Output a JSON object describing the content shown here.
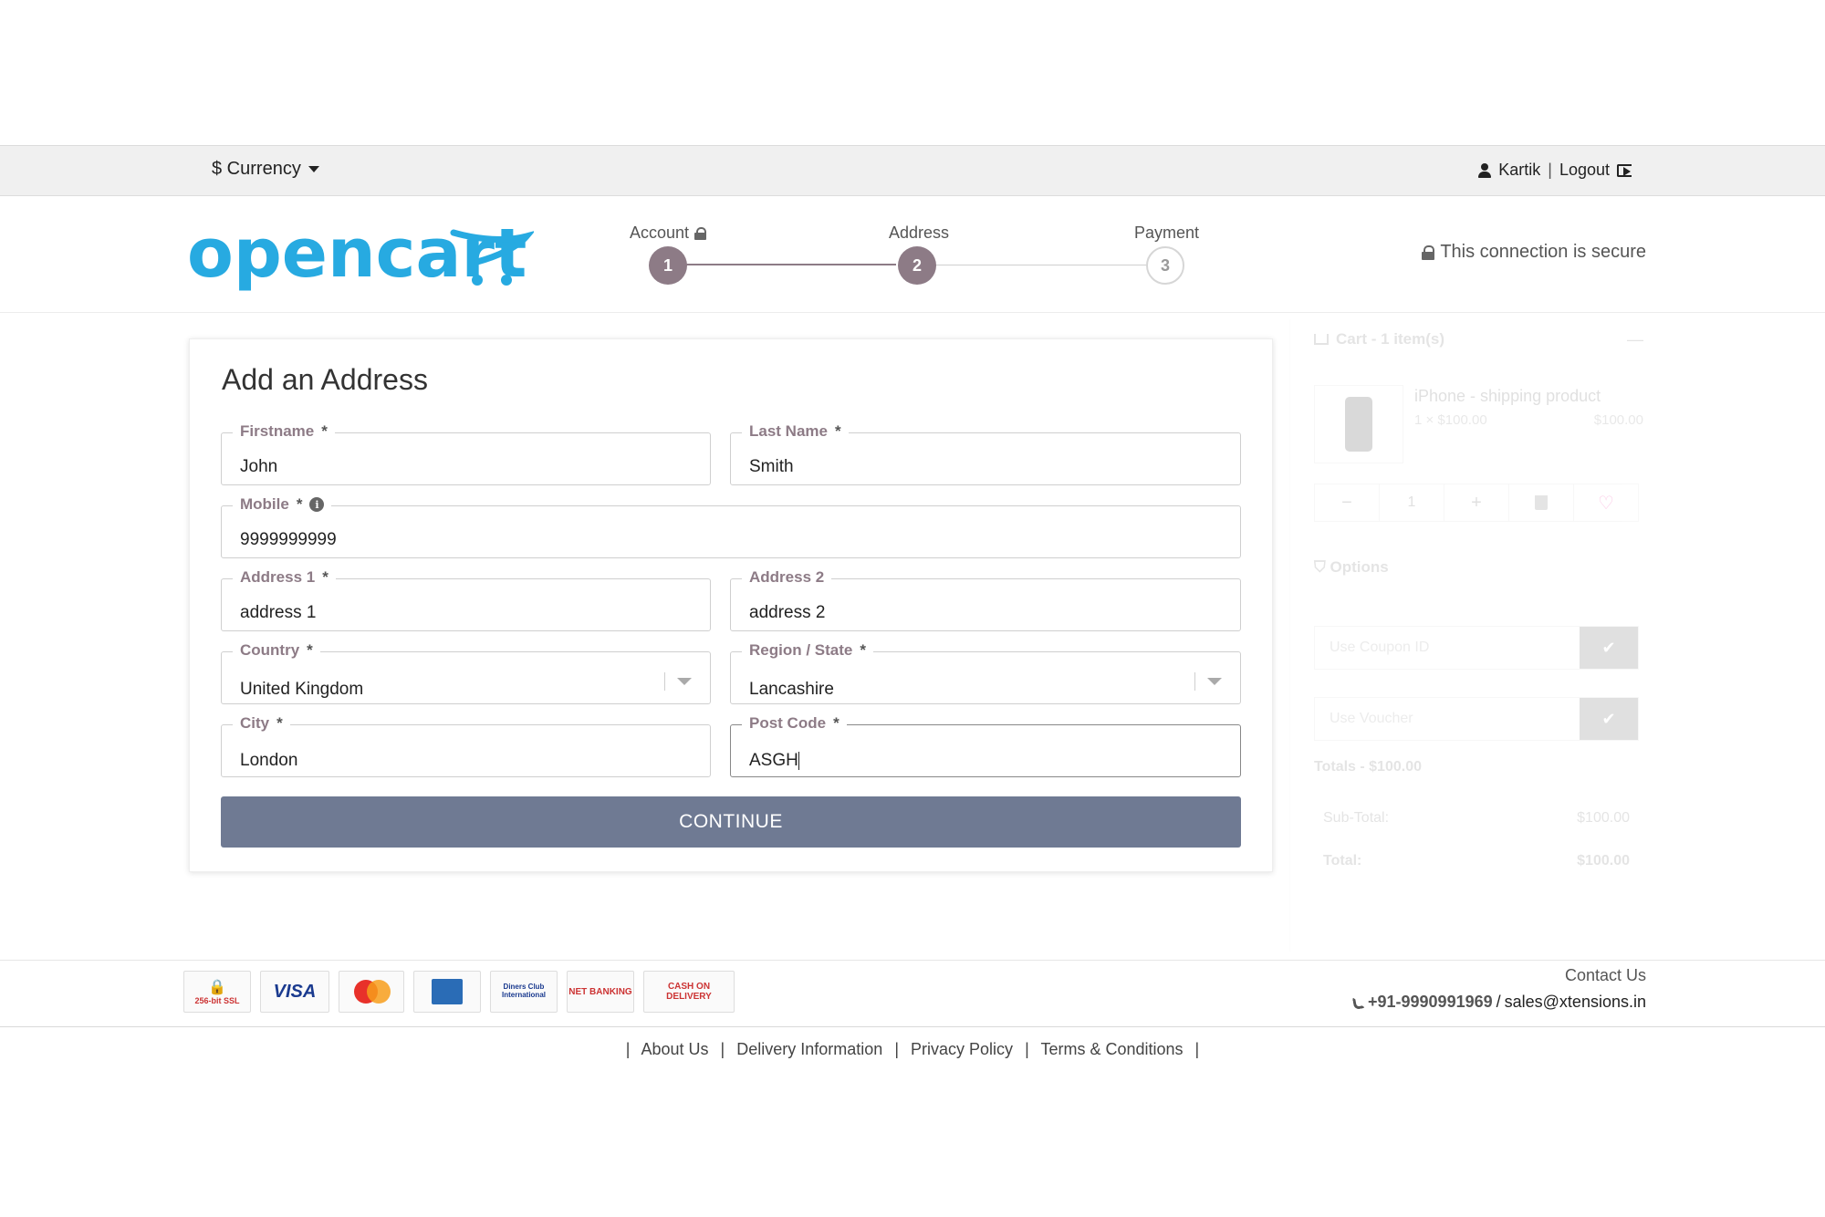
{
  "topbar": {
    "currency_label": "$ Currency",
    "user_name": "Kartik",
    "separator": "|",
    "logout_label": "Logout"
  },
  "header": {
    "logo_text": "opencart",
    "secure_text": "This connection is secure",
    "steps": [
      {
        "label": "Account",
        "number": "1",
        "state": "done"
      },
      {
        "label": "Address",
        "number": "2",
        "state": "current"
      },
      {
        "label": "Payment",
        "number": "3",
        "state": "todo"
      }
    ]
  },
  "form": {
    "title": "Add an Address",
    "required_mark": "*",
    "firstname": {
      "label": "Firstname",
      "value": "John"
    },
    "lastname": {
      "label": "Last Name",
      "value": "Smith"
    },
    "mobile": {
      "label": "Mobile",
      "value": "9999999999",
      "info": "i"
    },
    "address1": {
      "label": "Address 1",
      "value": "address 1"
    },
    "address2": {
      "label": "Address 2",
      "value": "address 2"
    },
    "country": {
      "label": "Country",
      "value": "United Kingdom"
    },
    "region": {
      "label": "Region / State",
      "value": "Lancashire"
    },
    "city": {
      "label": "City",
      "value": "London"
    },
    "postcode": {
      "label": "Post Code",
      "value": "ASGH"
    },
    "continue_label": "CONTINUE"
  },
  "cart": {
    "title": "Cart - 1 item(s)",
    "collapse": "—",
    "product_name": "iPhone - shipping product",
    "qty_line": "1 × $100.00",
    "line_price": "$100.00",
    "qty_minus": "−",
    "qty_value": "1",
    "qty_plus": "+",
    "options_label": "Options",
    "coupon_placeholder": "Use Coupon ID",
    "voucher_placeholder": "Use Voucher",
    "apply_glyph": "✔",
    "totals_title": "Totals - $100.00",
    "subtotal_label": "Sub-Total:",
    "subtotal_value": "$100.00",
    "total_label": "Total:",
    "total_value": "$100.00"
  },
  "footer": {
    "payment_badges": [
      "256-bit SSL",
      "VISA",
      "MasterCard",
      "American Express",
      "Diners Club International",
      "NET BANKING",
      "CASH ON DELIVERY"
    ],
    "contact_title": "Contact Us",
    "phone": "+91-9990991969",
    "contact_sep": "/",
    "email": "sales@xtensions.in",
    "links": [
      "About Us",
      "Delivery Information",
      "Privacy Policy",
      "Terms & Conditions"
    ],
    "link_pipe": "|"
  }
}
